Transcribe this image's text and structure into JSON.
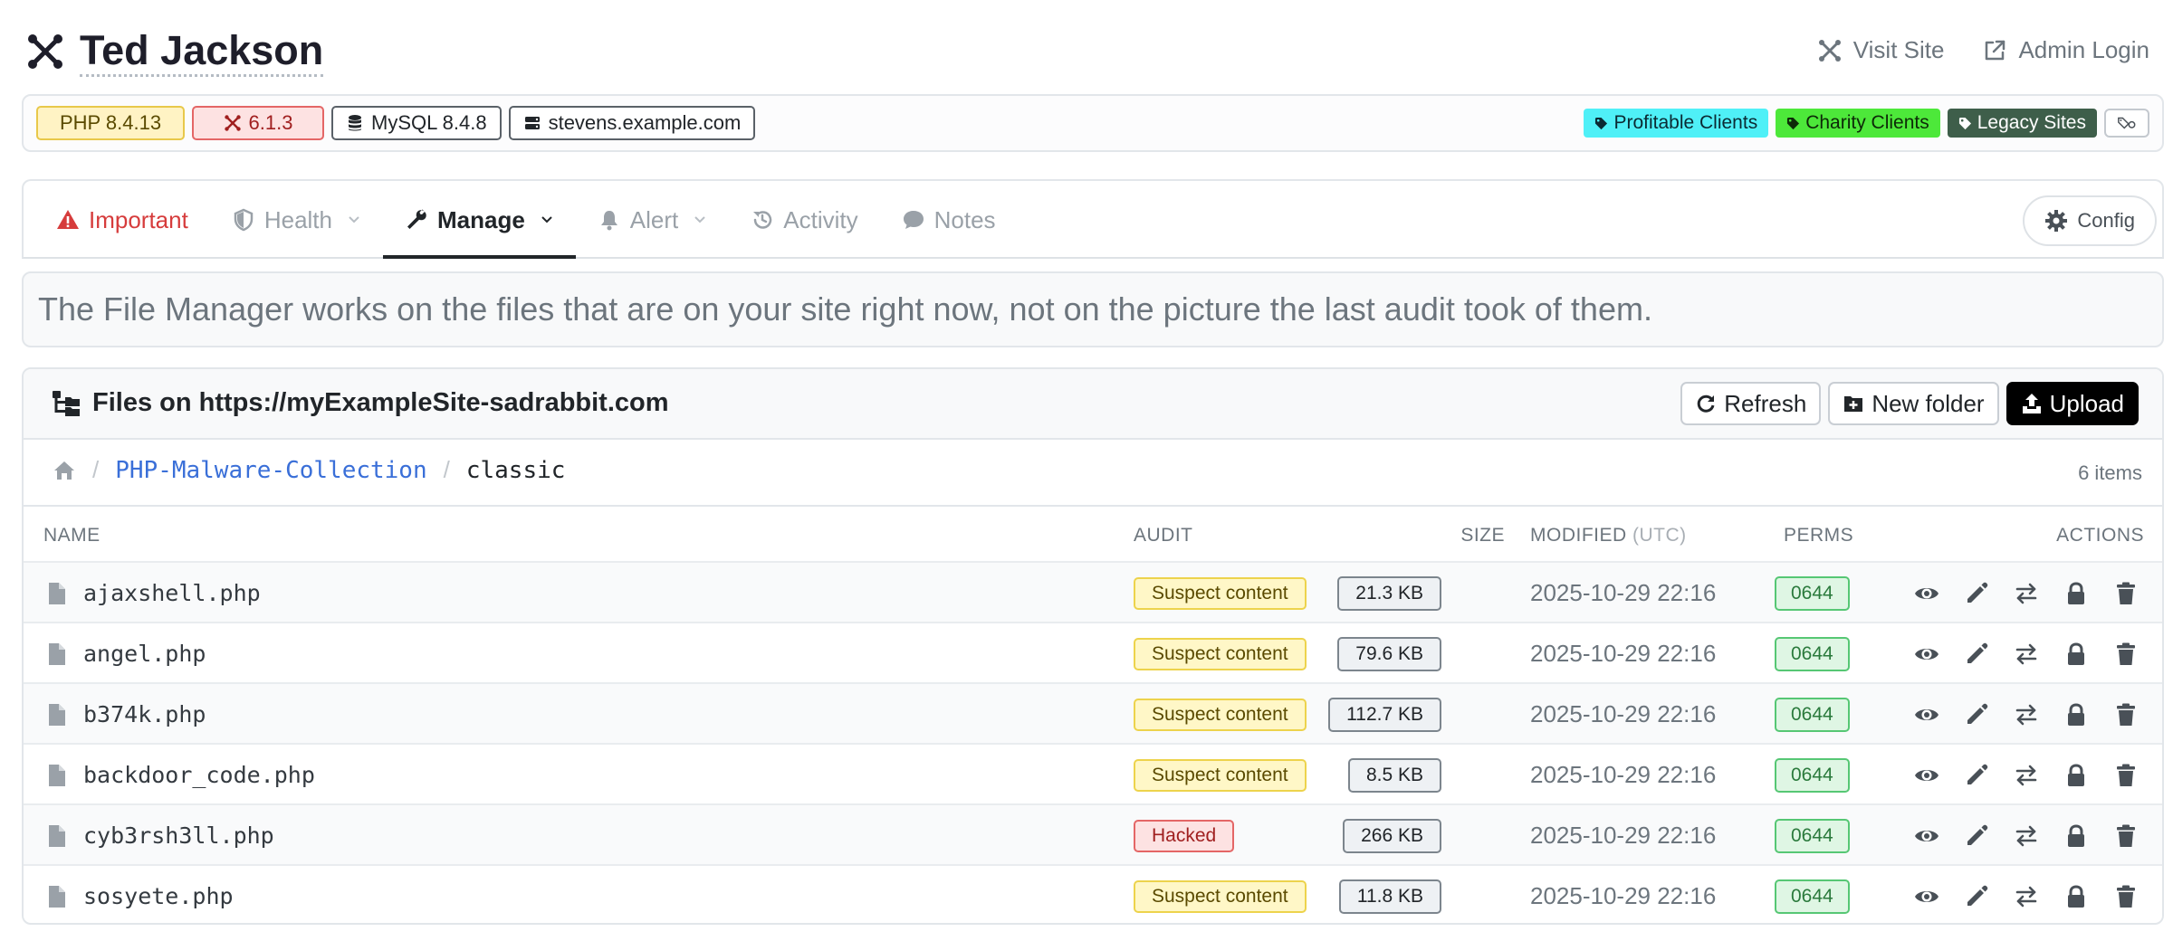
{
  "header": {
    "site_name": "Ted Jackson",
    "visit_site": "Visit Site",
    "admin_login": "Admin Login"
  },
  "badges": {
    "php": "PHP 8.4.13",
    "joomla": "6.1.3",
    "mysql": "MySQL 8.4.8",
    "host": "stevens.example.com"
  },
  "tags": [
    {
      "label": "Profitable Clients",
      "color": "#4ff0f7"
    },
    {
      "label": "Charity Clients",
      "color": "#4de83a"
    },
    {
      "label": "Legacy Sites",
      "color": "#3e5e4a"
    }
  ],
  "tabs": {
    "important": "Important",
    "health": "Health",
    "manage": "Manage",
    "alert": "Alert",
    "activity": "Activity",
    "notes": "Notes",
    "config": "Config"
  },
  "info_text": "The File Manager works on the files that are on your site right now, not on the picture the last audit took of them.",
  "panel": {
    "title": "Files on https://myExampleSite-sadrabbit.com",
    "refresh": "Refresh",
    "new_folder": "New folder",
    "upload": "Upload",
    "crumb_parent": "PHP-Malware-Collection",
    "crumb_current": "classic",
    "item_count": "6 items"
  },
  "columns": {
    "name": "NAME",
    "audit": "AUDIT",
    "size": "SIZE",
    "modified": "MODIFIED",
    "modified_tz": "(UTC)",
    "perms": "PERMS",
    "actions": "ACTIONS"
  },
  "files": [
    {
      "name": "ajaxshell.php",
      "audit": "Suspect content",
      "status": "suspect",
      "size": "21.3 KB",
      "modified": "2025-10-29 22:16",
      "perms": "0644"
    },
    {
      "name": "angel.php",
      "audit": "Suspect content",
      "status": "suspect",
      "size": "79.6 KB",
      "modified": "2025-10-29 22:16",
      "perms": "0644"
    },
    {
      "name": "b374k.php",
      "audit": "Suspect content",
      "status": "suspect",
      "size": "112.7 KB",
      "modified": "2025-10-29 22:16",
      "perms": "0644"
    },
    {
      "name": "backdoor_code.php",
      "audit": "Suspect content",
      "status": "suspect",
      "size": "8.5 KB",
      "modified": "2025-10-29 22:16",
      "perms": "0644"
    },
    {
      "name": "cyb3rsh3ll.php",
      "audit": "Hacked",
      "status": "hacked",
      "size": "266 KB",
      "modified": "2025-10-29 22:16",
      "perms": "0644"
    },
    {
      "name": "sosyete.php",
      "audit": "Suspect content",
      "status": "suspect",
      "size": "11.8 KB",
      "modified": "2025-10-29 22:16",
      "perms": "0644"
    }
  ]
}
